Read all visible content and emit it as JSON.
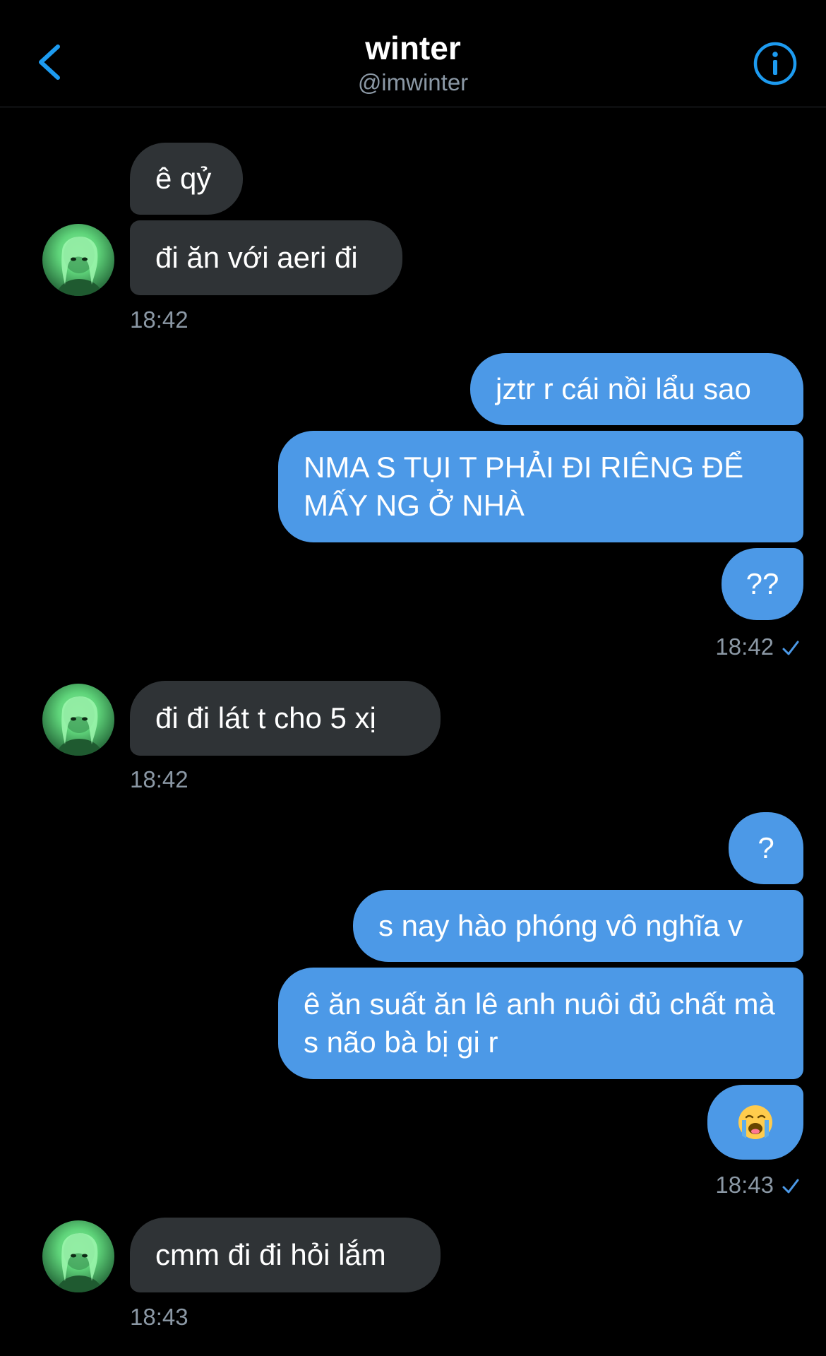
{
  "header": {
    "title": "winter",
    "handle": "@imwinter"
  },
  "colors": {
    "background": "#000000",
    "incoming_bubble": "#2f3336",
    "outgoing_bubble": "#4c99e7",
    "accent": "#1d9bf0",
    "muted_text": "#8b98a5"
  },
  "messages": {
    "g1": {
      "m1": "ê qỷ",
      "m2": "đi ăn với aeri đi",
      "time": "18:42"
    },
    "g2": {
      "m1": "jztr r cái nồi lẩu sao",
      "m2": "NMA S TỤI T PHẢI ĐI RIÊNG ĐỂ MẤY NG Ở NHÀ",
      "m3": "??",
      "time": "18:42"
    },
    "g3": {
      "m1": "đi đi lát t cho 5 xị",
      "time": "18:42"
    },
    "g4": {
      "m1": "?",
      "m2": "s nay hào phóng vô nghĩa v",
      "m3": "ê ăn suất ăn lê anh nuôi đủ chất mà s não bà bị gi r",
      "m4_emoji": "loudly-crying-face-emoji",
      "time": "18:43"
    },
    "g5": {
      "m1": "cmm đi đi hỏi lắm",
      "time": "18:43"
    }
  }
}
